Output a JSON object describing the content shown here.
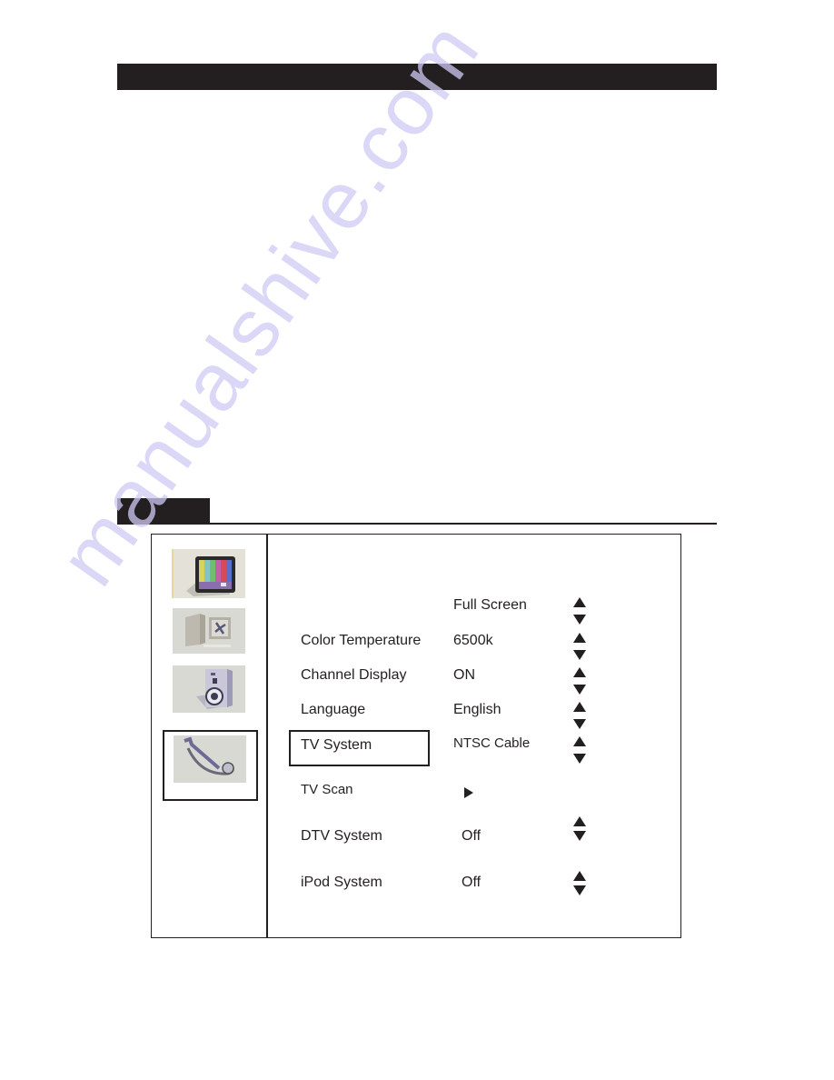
{
  "page": {
    "header_bar_text": "",
    "section_tab_text": ""
  },
  "watermark": {
    "text": "manualshive.com",
    "color": "#cfcaf5"
  },
  "menu": {
    "categories": [
      {
        "id": "picture",
        "icon": "tv-test-pattern-icon",
        "selected": false
      },
      {
        "id": "screen",
        "icon": "computer-monitor-icon",
        "selected": false
      },
      {
        "id": "audio",
        "icon": "speaker-icon",
        "selected": false
      },
      {
        "id": "setup",
        "icon": "wrench-tool-icon",
        "selected": true
      }
    ],
    "rows": [
      {
        "label": "",
        "value": "Full Screen",
        "control": "up-down"
      },
      {
        "label": "Color Temperature",
        "value": "6500k",
        "control": "up-down"
      },
      {
        "label": "Channel Display",
        "value": "ON",
        "control": "up-down"
      },
      {
        "label": "Language",
        "value": "English",
        "control": "up-down"
      },
      {
        "label": "TV System",
        "value": "NTSC Cable",
        "control": "up-down",
        "selected": true
      },
      {
        "label": "TV Scan",
        "value": "",
        "control": "enter-arrow"
      },
      {
        "label": "DTV System",
        "value": "Off",
        "control": "up-down"
      },
      {
        "label": "iPod System",
        "value": "Off",
        "control": "up-down"
      }
    ]
  },
  "colors": {
    "ink": "#231f20",
    "background": "#ffffff"
  }
}
